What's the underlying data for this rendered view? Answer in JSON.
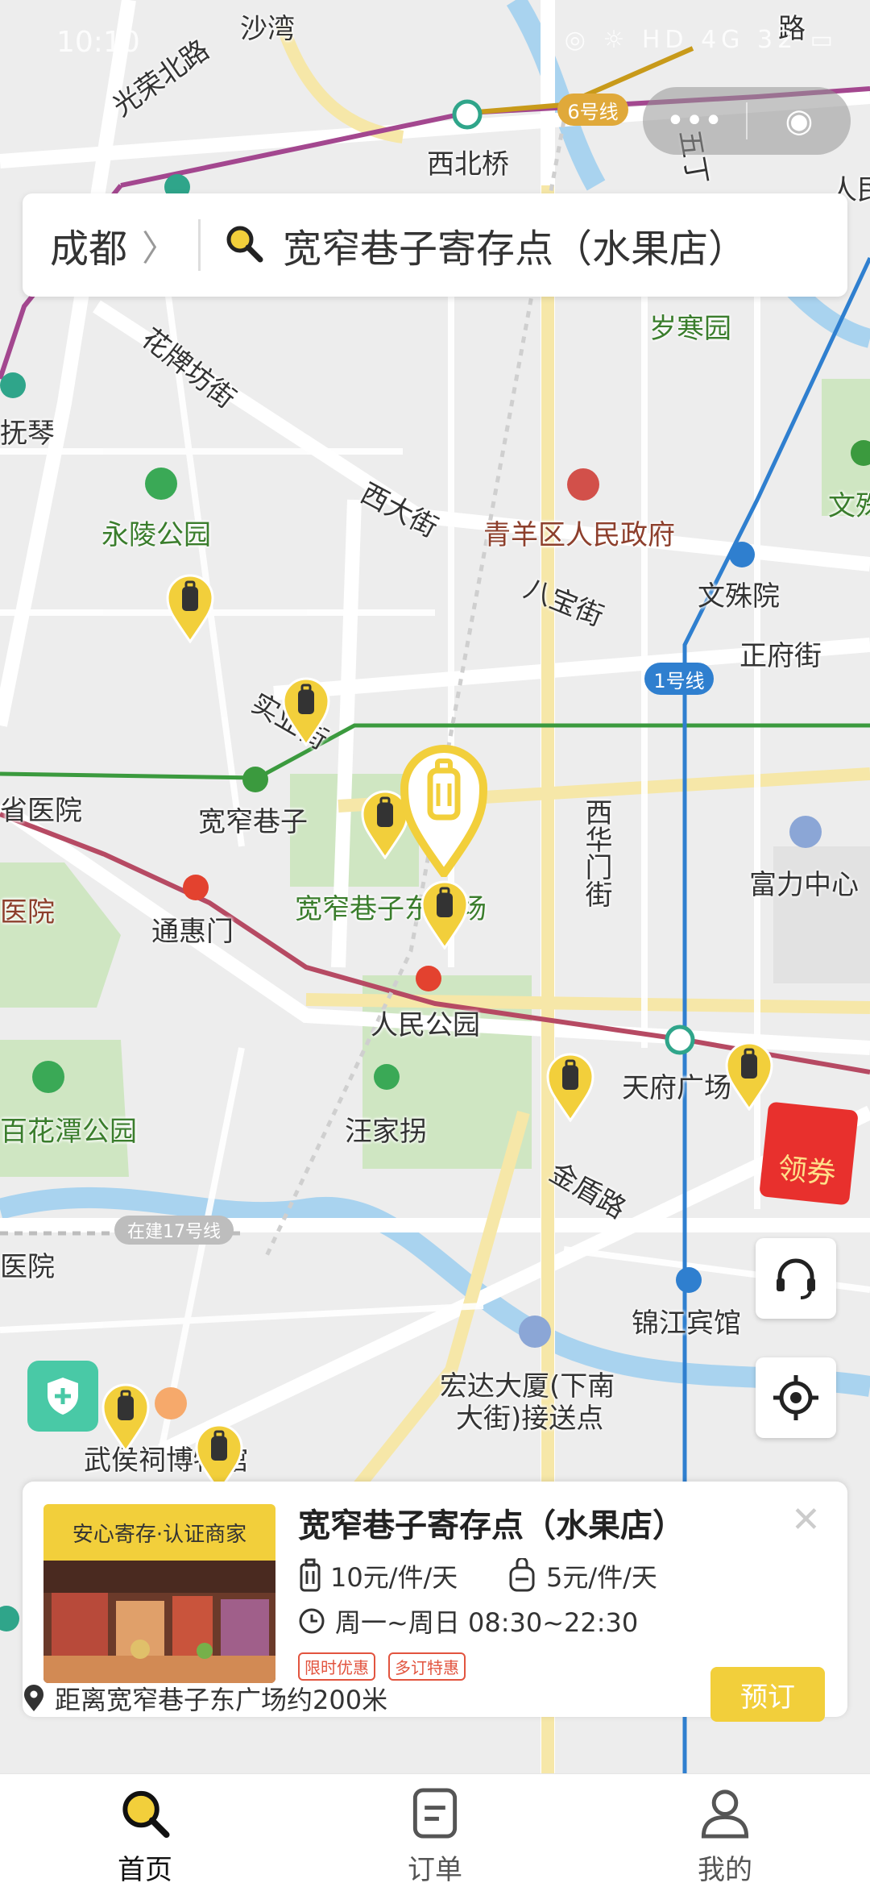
{
  "status_bar": {
    "time": "10:10",
    "icons": "◎ ☼ HD 4G 32 ▭"
  },
  "capsule": {
    "menu": "•••",
    "close": "◉"
  },
  "search": {
    "city": "成都",
    "chevron": "〉",
    "query": "宽窄巷子寄存点（水果店）"
  },
  "map": {
    "labels": [
      "沙湾",
      "光荣北路",
      "西北桥",
      "五丁",
      "路",
      "人民",
      "花牌坊街",
      "岁寒园",
      "抚琴",
      "永陵公园",
      "西大街",
      "青羊区人民政府",
      "八宝街",
      "文殊院",
      "文殊",
      "正府街",
      "实业街",
      "宽窄巷子",
      "省医院",
      "西华门街",
      "富力中心",
      "宽窄巷子东广场",
      "通惠门",
      "人民公园",
      "天府广场",
      "医院",
      "百花潭公园",
      "汪家拐",
      "金盾路",
      "锦江宾馆",
      "医院",
      "宏达大厦(下南",
      "大街)接送点",
      "武侯祠博物馆"
    ],
    "line_badges": {
      "line6": "6号线",
      "line1": "1号线",
      "line17": "在建17号线",
      "line1_bottom": "1号线"
    }
  },
  "coupon": {
    "label": "领券"
  },
  "card": {
    "badge": "安心寄存·认证商家",
    "title": "宽窄巷子寄存点（水果店）",
    "close": "✕",
    "price_luggage": "10元/件/天",
    "price_bag": "5元/件/天",
    "hours": "周一~周日 08:30~22:30",
    "tags": [
      "限时优惠",
      "多订特惠"
    ],
    "book_label": "预订",
    "distance": "距离宽窄巷子东广场约200米"
  },
  "nav": {
    "home": "首页",
    "orders": "订单",
    "mine": "我的"
  },
  "colors": {
    "accent": "#f2cf3b",
    "home_active": "#111111",
    "line1": "#2f7fcf",
    "line2": "#3b9a3e",
    "line6": "#c89a1a",
    "line4": "#b64a63"
  }
}
